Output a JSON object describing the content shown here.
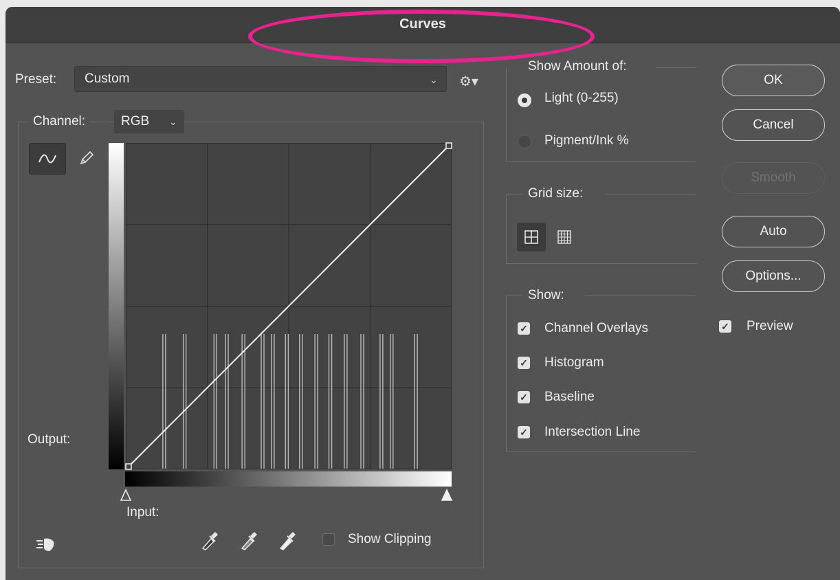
{
  "dialog": {
    "title": "Curves"
  },
  "preset": {
    "label": "Preset:",
    "value": "Custom"
  },
  "channel": {
    "label": "Channel:",
    "value": "RGB"
  },
  "graph": {
    "output_label": "Output:",
    "input_label": "Input:"
  },
  "clipping": {
    "label": "Show Clipping",
    "checked": false
  },
  "show_amount": {
    "label": "Show Amount of:",
    "options": [
      {
        "label": "Light  (0-255)",
        "selected": true
      },
      {
        "label": "Pigment/Ink %",
        "selected": false
      }
    ]
  },
  "grid_size": {
    "label": "Grid size:",
    "selected": "simple"
  },
  "show": {
    "label": "Show:",
    "items": [
      {
        "label": "Channel Overlays",
        "checked": true
      },
      {
        "label": "Histogram",
        "checked": true
      },
      {
        "label": "Baseline",
        "checked": true
      },
      {
        "label": "Intersection Line",
        "checked": true
      }
    ]
  },
  "buttons": {
    "ok": "OK",
    "cancel": "Cancel",
    "smooth": "Smooth",
    "auto": "Auto",
    "options": "Options..."
  },
  "preview": {
    "label": "Preview",
    "checked": true
  },
  "curve_points": [
    {
      "input": 0,
      "output": 0
    },
    {
      "input": 255,
      "output": 255
    }
  ],
  "histogram_peaks_input": [
    29,
    45,
    69,
    78,
    91,
    106,
    114,
    125,
    136,
    148,
    159,
    171,
    184,
    199,
    207,
    226
  ],
  "colors": {
    "highlight": "#e8238f",
    "dialog_bg": "#535353",
    "title_bar": "#3f3f3f"
  }
}
